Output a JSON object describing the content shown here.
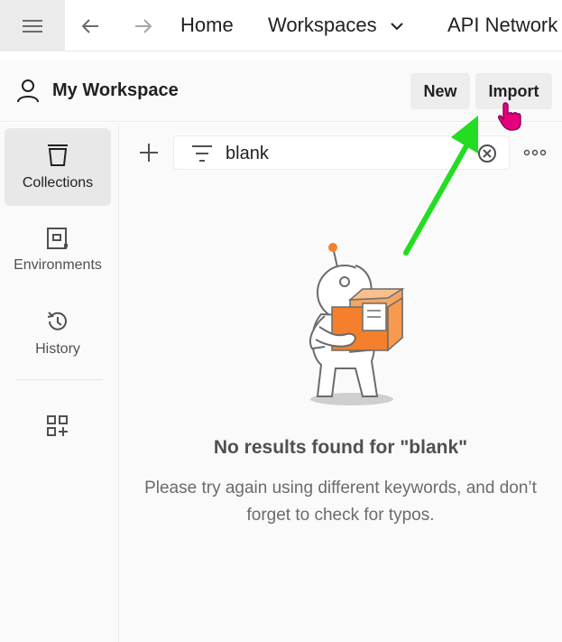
{
  "topbar": {
    "menu_icon": "hamburger-icon",
    "back_icon": "arrow-left-icon",
    "forward_icon": "arrow-right-icon",
    "home_label": "Home",
    "workspaces_label": "Workspaces",
    "api_network_label": "API Network"
  },
  "workspace": {
    "title": "My Workspace",
    "new_label": "New",
    "import_label": "Import"
  },
  "sidebar": {
    "items": [
      {
        "label": "Collections",
        "icon": "trash-bin-icon",
        "active": true
      },
      {
        "label": "Environments",
        "icon": "environment-icon",
        "active": false
      },
      {
        "label": "History",
        "icon": "history-icon",
        "active": false
      }
    ],
    "configure_icon": "add-workbench-icon"
  },
  "collections": {
    "search_value": "blank",
    "empty_title": "No results found for \"blank\"",
    "empty_text": "Please try again using different keywords, and don’t forget to check for typos."
  },
  "colors": {
    "accent_orange": "#f47f2c",
    "annotation_arrow": "#22dd22",
    "cursor": "#e6007e"
  }
}
